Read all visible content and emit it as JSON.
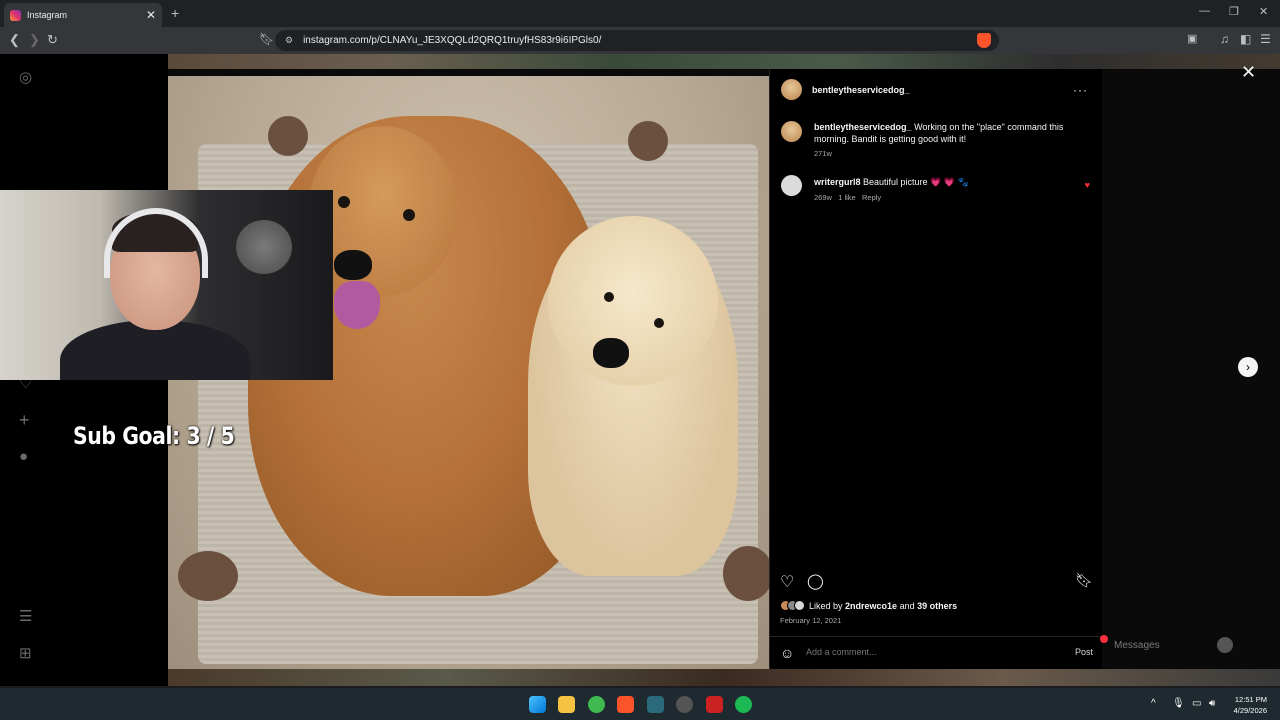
{
  "browser": {
    "tab_title": "Instagram",
    "tab_close": "✕",
    "new_tab": "+",
    "url": "instagram.com/p/CLNAYu_JE3XQQLd2QRQ1truyfHS83r9i6IPGls0/",
    "window_controls": [
      "—",
      "❐",
      "✕"
    ]
  },
  "overlay": {
    "sub_goal": "Sub Goal:  3 / 5"
  },
  "post": {
    "author": "bentleytheservicedog_",
    "more": "···",
    "caption_author": "bentleytheservicedog_",
    "caption": "Working on the \"place\" command this morning. Bandit is getting good with it!",
    "caption_age": "271w",
    "comments": [
      {
        "user": "writergurl8",
        "text": "Beautiful picture",
        "emoji": "💗 💗 🐾",
        "age": "269w",
        "likes": "1 like",
        "reply": "Reply"
      }
    ],
    "liked_by_prefix": "Liked by ",
    "liked_by_user": "2ndrewco1e",
    "liked_by_mid": " and ",
    "liked_by_others": "39 others",
    "date": "February 12, 2021",
    "comment_placeholder": "Add a comment...",
    "post_button": "Post"
  },
  "messages_label": "Messages",
  "taskbar": {
    "time": "12:51 PM",
    "date": "4/29/2026"
  },
  "colors": {
    "like_red": "#ff3040",
    "panel_bg": "#000000",
    "instagram_gradient": [
      "#f9a33a",
      "#e1306c",
      "#833ab4"
    ]
  }
}
